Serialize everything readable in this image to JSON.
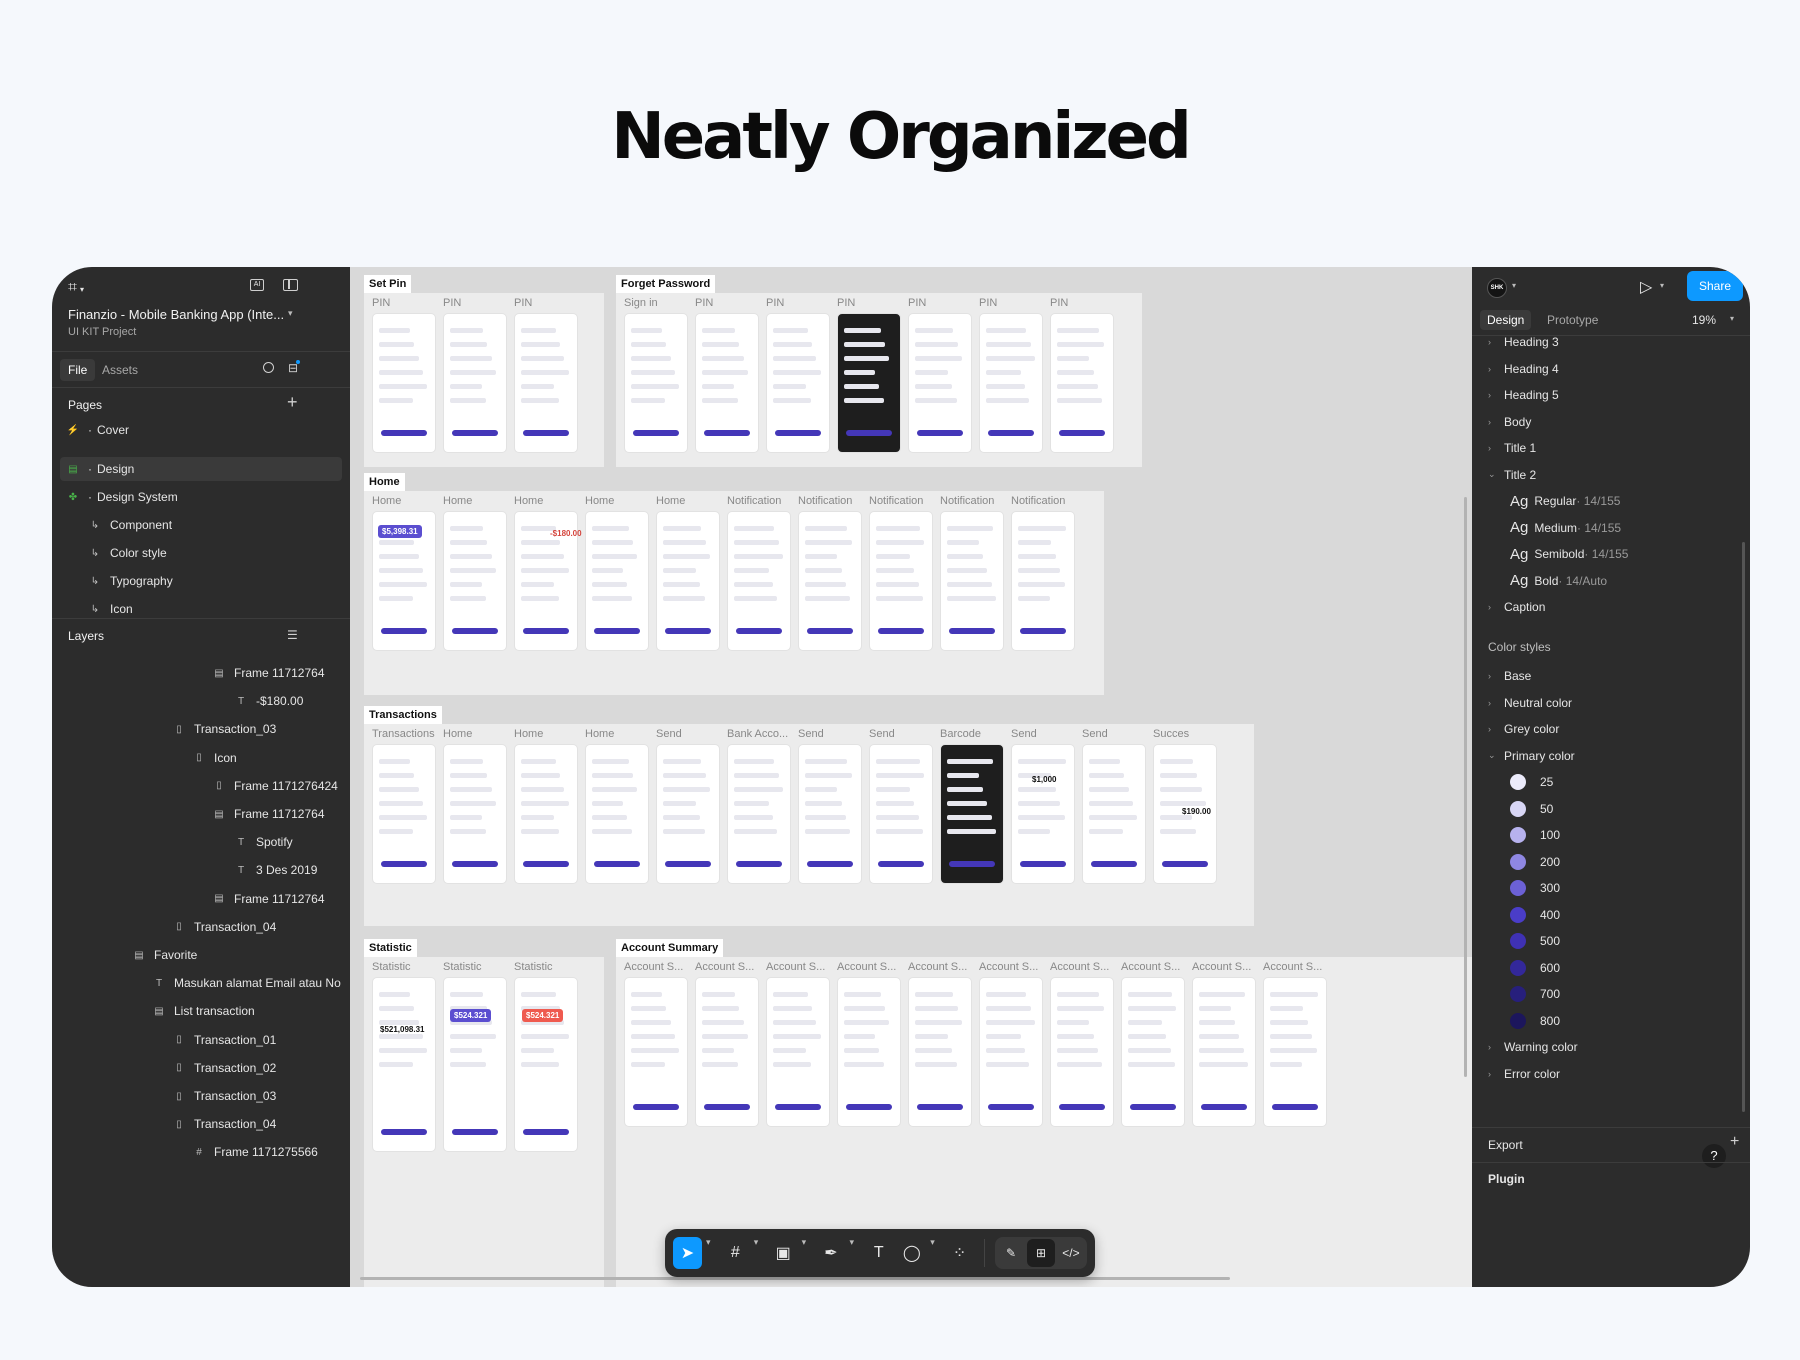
{
  "hero_title": "Neatly Organized",
  "left_panel": {
    "file_name": "Finanzio - Mobile Banking App (Inte...",
    "subtitle": "UI KIT Project",
    "tabs": [
      "File",
      "Assets"
    ],
    "pages_title": "Pages",
    "pages": [
      {
        "label": "Cover",
        "icon": "bolt-icon"
      },
      {
        "label": "Design",
        "icon": "frame-icon",
        "selected": true
      },
      {
        "label": "Design System",
        "icon": "puzzle-icon"
      },
      {
        "label": "Component",
        "icon": "arrow-icon"
      },
      {
        "label": "Color style",
        "icon": "arrow-icon"
      },
      {
        "label": "Typography",
        "icon": "arrow-icon"
      },
      {
        "label": "Icon",
        "icon": "arrow-icon"
      }
    ],
    "layers_title": "Layers",
    "layers": [
      {
        "label": "Frame 11712764",
        "icon": "frame-icon"
      },
      {
        "label": "-$180.00",
        "icon": "text-icon"
      },
      {
        "label": "Transaction_03",
        "icon": "component-icon"
      },
      {
        "label": "Icon",
        "icon": "component-icon"
      },
      {
        "label": "Frame 1171276424",
        "icon": "component-icon"
      },
      {
        "label": "Frame 11712764",
        "icon": "frame-icon"
      },
      {
        "label": "Spotify",
        "icon": "text-icon"
      },
      {
        "label": "3 Des 2019",
        "icon": "text-icon"
      },
      {
        "label": "Frame 11712764",
        "icon": "frame-icon"
      },
      {
        "label": "Transaction_04",
        "icon": "component-icon"
      },
      {
        "label": "Favorite",
        "icon": "frame-icon"
      },
      {
        "label": "Masukan alamat Email atau No",
        "icon": "text-icon"
      },
      {
        "label": "List transaction",
        "icon": "frame-icon"
      },
      {
        "label": "Transaction_01",
        "icon": "component-icon"
      },
      {
        "label": "Transaction_02",
        "icon": "component-icon"
      },
      {
        "label": "Transaction_03",
        "icon": "component-icon"
      },
      {
        "label": "Transaction_04",
        "icon": "component-icon"
      },
      {
        "label": "Frame 1171275566",
        "icon": "hash-icon"
      }
    ]
  },
  "canvas": {
    "sections": [
      {
        "title": "Set Pin",
        "frames": [
          "PIN",
          "PIN",
          "PIN"
        ]
      },
      {
        "title": "Forget Password",
        "frames": [
          "Sign in",
          "PIN",
          "PIN",
          "PIN",
          "PIN",
          "PIN",
          "PIN"
        ]
      },
      {
        "title": "Home",
        "frames": [
          "Home",
          "Home",
          "Home",
          "Home",
          "Home",
          "Notification",
          "Notification",
          "Notification",
          "Notification",
          "Notification"
        ]
      },
      {
        "title": "Transactions",
        "frames": [
          "Transactions",
          "Home",
          "Home",
          "Home",
          "Send",
          "Bank Acco...",
          "Send",
          "Send",
          "Barcode",
          "Send",
          "Send",
          "Succes"
        ]
      },
      {
        "title": "Statistic",
        "frames": [
          "Statistic",
          "Statistic",
          "Statistic"
        ]
      },
      {
        "title": "Account Summary",
        "frames": [
          "Account S...",
          "Account S...",
          "Account S...",
          "Account S...",
          "Account S...",
          "Account S...",
          "Account S...",
          "Account S...",
          "Account S...",
          "Account S..."
        ]
      }
    ],
    "screen_texts": {
      "balance": "$5,398.31",
      "amount": "-$180.00",
      "statistic_total": "$521,098.31",
      "statistic_card_a": "$524.321",
      "statistic_card_b": "$524.321",
      "send_amount": "$1,000",
      "success_amount": "$190.00"
    }
  },
  "toolbar": {
    "tools": [
      {
        "name": "move-tool",
        "glyph": "➤",
        "active": true
      },
      {
        "name": "frame-tool",
        "glyph": "#"
      },
      {
        "name": "image-tool",
        "glyph": "▣"
      },
      {
        "name": "pen-tool",
        "glyph": "✒"
      },
      {
        "name": "text-tool",
        "glyph": "T"
      },
      {
        "name": "comment-tool",
        "glyph": "◯"
      },
      {
        "name": "components-tool",
        "glyph": "⁘"
      }
    ],
    "right_tools": [
      {
        "name": "draw-mode",
        "glyph": "✎"
      },
      {
        "name": "design-mode",
        "glyph": "⊞"
      },
      {
        "name": "dev-mode",
        "glyph": "</>"
      }
    ]
  },
  "right_panel": {
    "avatar": "SHK",
    "share_label": "Share",
    "tabs": [
      "Design",
      "Prototype"
    ],
    "zoom": "19%",
    "text_styles": [
      "Heading 3",
      "Heading 4",
      "Heading 5",
      "Body",
      "Title 1",
      "Title 2"
    ],
    "typo": [
      {
        "ag": "Ag",
        "name": "Regular",
        "meta": " · 14/155"
      },
      {
        "ag": "Ag",
        "name": "Medium",
        "meta": " · 14/155"
      },
      {
        "ag": "Ag",
        "name": "Semibold",
        "meta": " · 14/155"
      },
      {
        "ag": "Ag",
        "name": "Bold",
        "meta": " · 14/Auto"
      }
    ],
    "caption": "Caption",
    "color_styles_title": "Color styles",
    "color_groups": [
      "Base",
      "Neutral color",
      "Grey color",
      "Primary color"
    ],
    "primary_shades": [
      {
        "label": "25",
        "color": "#ecebfb"
      },
      {
        "label": "50",
        "color": "#d8d6f5"
      },
      {
        "label": "100",
        "color": "#b7b2ee"
      },
      {
        "label": "200",
        "color": "#8f87e2"
      },
      {
        "label": "300",
        "color": "#6c61d6"
      },
      {
        "label": "400",
        "color": "#4a3dc8"
      },
      {
        "label": "500",
        "color": "#3f31b4"
      },
      {
        "label": "600",
        "color": "#33289a"
      },
      {
        "label": "700",
        "color": "#271f7c"
      },
      {
        "label": "800",
        "color": "#1c165c"
      }
    ],
    "more_groups": [
      "Warning color",
      "Error color"
    ],
    "export_label": "Export",
    "plugin_label": "Plugin",
    "help_glyph": "?"
  }
}
